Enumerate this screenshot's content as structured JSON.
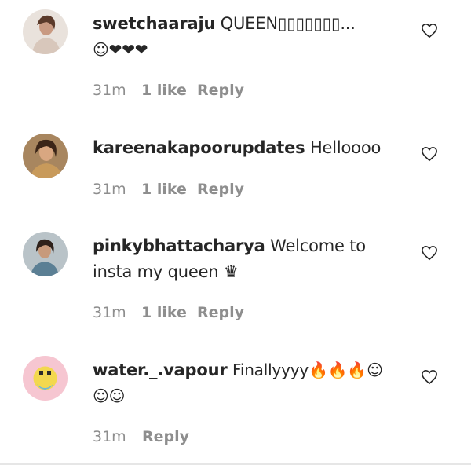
{
  "comments": [
    {
      "username": "swetchaaraju",
      "text_line1": "QUEEN▯▯▯▯▯▯▯...",
      "text_line2": "☺❤❤❤",
      "time": "31m",
      "likes": "1 like",
      "reply": "Reply"
    },
    {
      "username": "kareenakapoorupdates",
      "text_line1": "Helloooo",
      "time": "31m",
      "likes": "1 like",
      "reply": "Reply"
    },
    {
      "username": "pinkybhattacharya",
      "text_line1": "Welcome to",
      "text_line2": "insta my queen ♛",
      "time": "31m",
      "likes": "1 like",
      "reply": "Reply"
    },
    {
      "username": "water._.vapour",
      "text_line1": "Finallyyyy🔥🔥🔥☺",
      "text_line2": "☺☺",
      "time": "31m",
      "reply": "Reply"
    }
  ],
  "colors": {
    "text": "#262626",
    "meta": "#8e8e8e",
    "heart_stroke": "#262626"
  },
  "icons": {
    "like": "heart-outline-icon"
  }
}
